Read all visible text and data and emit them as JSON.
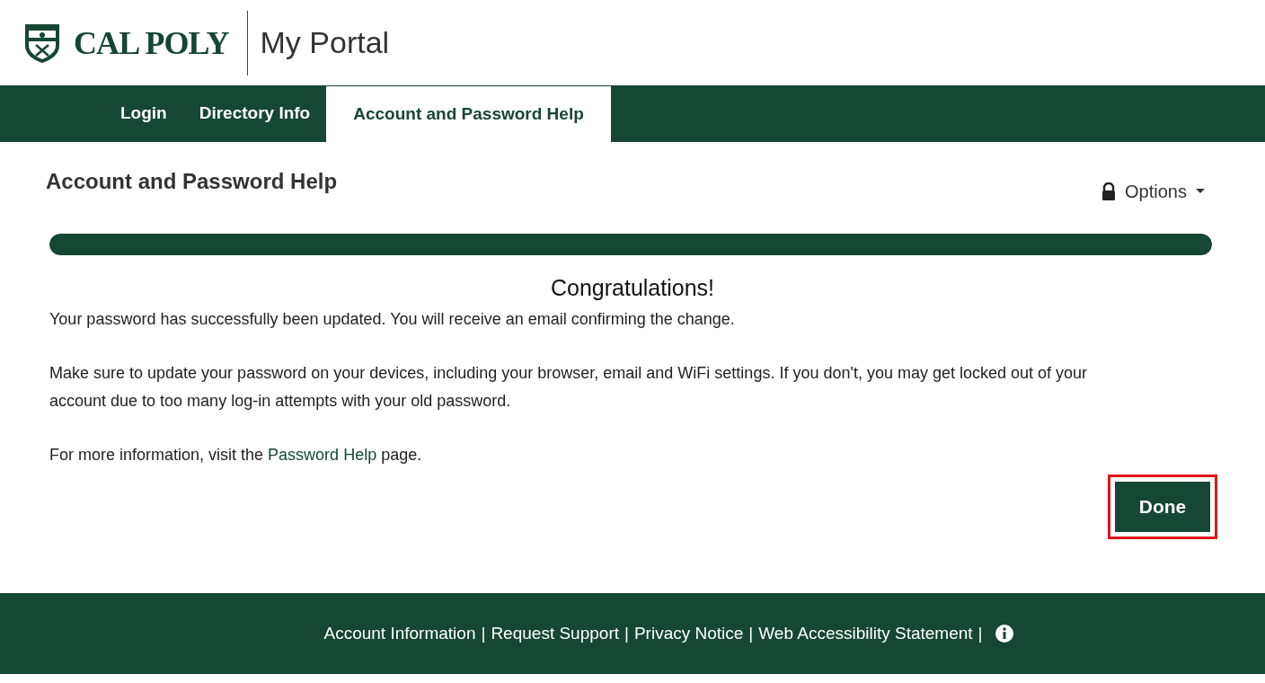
{
  "header": {
    "logo_text": "CAL POLY",
    "portal_title": "My Portal"
  },
  "tabs": [
    {
      "label": "Login",
      "selected": false
    },
    {
      "label": "Directory Info",
      "selected": false
    },
    {
      "label": "Account and Password Help",
      "selected": true
    }
  ],
  "page": {
    "title": "Account and Password Help",
    "options_label": "Options"
  },
  "progress": {
    "level": 1
  },
  "message": {
    "heading": "Congratulations!",
    "paragraphs": [
      "Your password has successfully been updated. You will receive an email confirming the change.",
      "Make sure to update your password on your devices, including your browser, email and WiFi settings. If you don't, you may get locked out of your account due to too many log-in attempts with your old password."
    ],
    "info_before": "For more information, visit the",
    "info_link": "Password Help",
    "info_after": "page."
  },
  "done_button": {
    "label": "Done",
    "highlighted": true
  },
  "footer": {
    "separator": "|",
    "links": [
      "Account Information",
      "Request Support",
      "Privacy Notice",
      "Web Accessibility Statement"
    ]
  }
}
